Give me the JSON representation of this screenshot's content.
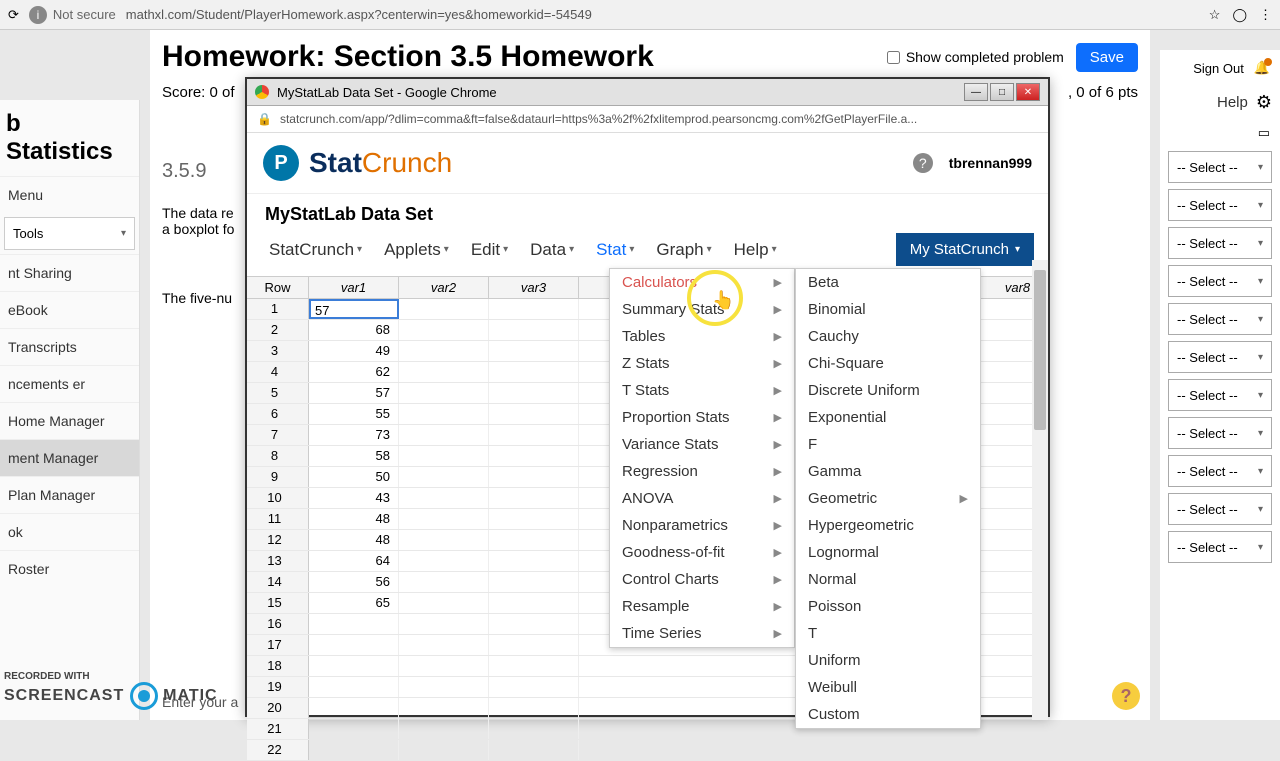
{
  "browser": {
    "security": "Not secure",
    "url": "mathxl.com/Student/PlayerHomework.aspx?centerwin=yes&homeworkid=-54549"
  },
  "top_right": {
    "signout": "Sign Out"
  },
  "sidebar": {
    "title": "b Statistics",
    "menu": "Menu",
    "tools": "Tools",
    "items": [
      "nt Sharing",
      "eBook",
      "Transcripts",
      "ncements\ner",
      "Home Manager",
      "ment Manager",
      "Plan Manager",
      "ok",
      "Roster"
    ],
    "active_index": 5
  },
  "homework": {
    "title": "Homework: Section 3.5 Homework",
    "show_completed": "Show completed problem",
    "save": "Save",
    "score": "Score: 0 of",
    "pts": ", 0 of 6 pts",
    "qnum": "3.5.9",
    "qtext1": "The data re",
    "qtext2": "a boxplot fo",
    "five_num": "The five-nu",
    "enter": "Enter your a",
    "help": "Help"
  },
  "selects": {
    "label": "-- Select --",
    "count": 11
  },
  "popup": {
    "title": "MyStatLab Data Set - Google Chrome",
    "url": "statcrunch.com/app/?dlim=comma&ft=false&dataurl=https%3a%2f%2fxlitemprod.pearsoncmg.com%2fGetPlayerFile.a...",
    "brand_stat": "Stat",
    "brand_crunch": "Crunch",
    "username": "tbrennan999",
    "dataset": "MyStatLab Data Set",
    "menus": [
      "StatCrunch",
      "Applets",
      "Edit",
      "Data",
      "Stat",
      "Graph",
      "Help"
    ],
    "active_menu": 4,
    "mystat": "My StatCrunch",
    "headers": [
      "Row",
      "var1",
      "var2",
      "var3"
    ],
    "far_header": "var8",
    "var1_values": [
      "57",
      "68",
      "49",
      "62",
      "57",
      "55",
      "73",
      "58",
      "50",
      "43",
      "48",
      "48",
      "64",
      "56",
      "65"
    ],
    "total_rows": 22
  },
  "stat_menu": {
    "items": [
      {
        "label": "Calculators",
        "sub": true,
        "hl": true
      },
      {
        "label": "Summary Stats",
        "sub": true
      },
      {
        "label": "Tables",
        "sub": true
      },
      {
        "label": "Z Stats",
        "sub": true
      },
      {
        "label": "T Stats",
        "sub": true
      },
      {
        "label": "Proportion Stats",
        "sub": true
      },
      {
        "label": "Variance Stats",
        "sub": true
      },
      {
        "label": "Regression",
        "sub": true
      },
      {
        "label": "ANOVA",
        "sub": true
      },
      {
        "label": "Nonparametrics",
        "sub": true
      },
      {
        "label": "Goodness-of-fit",
        "sub": true
      },
      {
        "label": "Control Charts",
        "sub": true
      },
      {
        "label": "Resample",
        "sub": true
      },
      {
        "label": "Time Series",
        "sub": true
      }
    ]
  },
  "calc_menu": {
    "items": [
      {
        "label": "Beta"
      },
      {
        "label": "Binomial"
      },
      {
        "label": "Cauchy"
      },
      {
        "label": "Chi-Square"
      },
      {
        "label": "Discrete Uniform"
      },
      {
        "label": "Exponential"
      },
      {
        "label": "F"
      },
      {
        "label": "Gamma"
      },
      {
        "label": "Geometric",
        "sub": true
      },
      {
        "label": "Hypergeometric"
      },
      {
        "label": "Lognormal"
      },
      {
        "label": "Normal"
      },
      {
        "label": "Poisson"
      },
      {
        "label": "T"
      },
      {
        "label": "Uniform"
      },
      {
        "label": "Weibull"
      },
      {
        "label": "Custom"
      }
    ]
  },
  "watermark": {
    "line1": "RECORDED WITH",
    "line2": "SCREENCAST",
    "line3": "MATIC"
  }
}
